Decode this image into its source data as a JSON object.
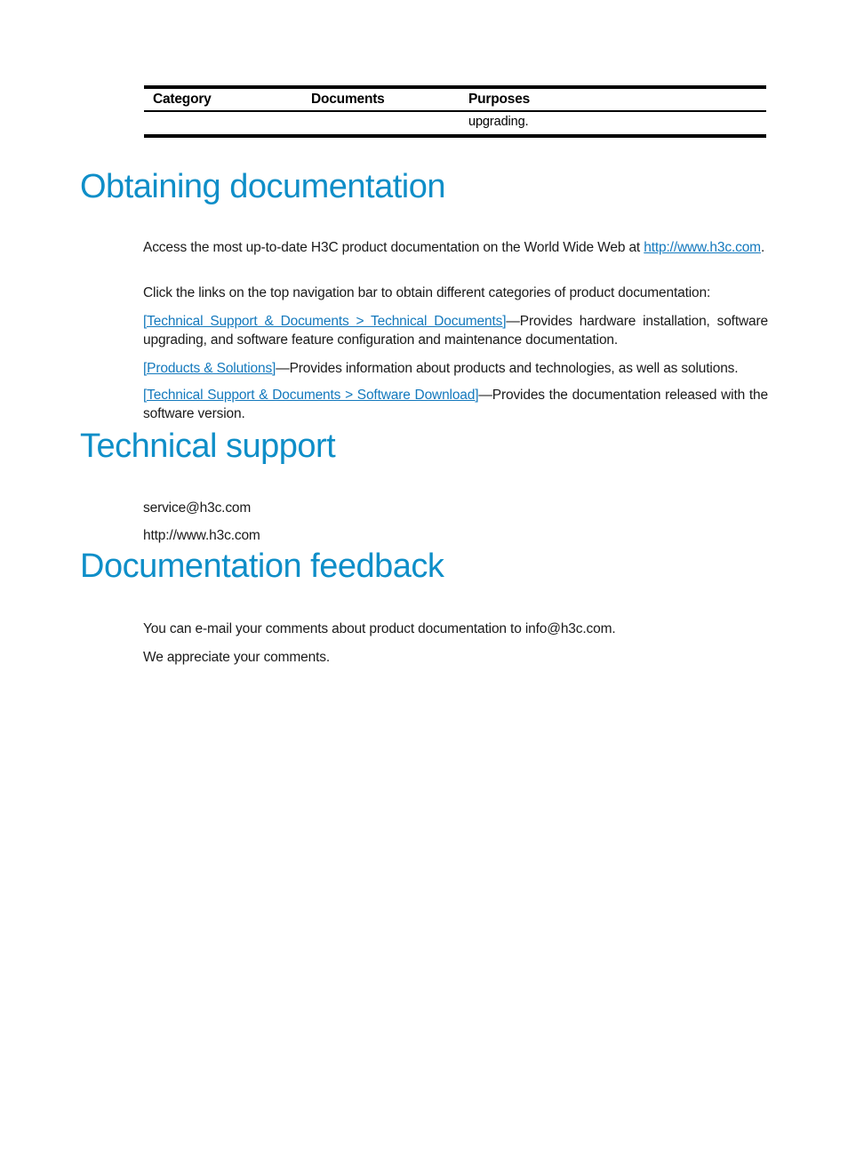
{
  "table": {
    "headers": {
      "category": "Category",
      "documents": "Documents",
      "purposes": "Purposes"
    },
    "rows": [
      {
        "category": "",
        "documents": "",
        "purposes": "upgrading."
      }
    ]
  },
  "colors": {
    "heading_blue": "#0e8ec8",
    "link_blue": "#1479bd",
    "rule_black": "#000000",
    "body_text": "#1a1a1a"
  },
  "sections": {
    "obtaining": {
      "heading": "Obtaining documentation",
      "paragraph_access_pre": "Access the most up-to-date H3C product documentation on the World Wide Web at ",
      "paragraph_access_link": "http://www.h3c.com",
      "paragraph_access_post": ".",
      "paragraph_click": "Click the links on the top navigation bar to obtain different categories of product documentation:",
      "links": [
        {
          "label": "[Technical Support & Documents > Technical Documents]",
          "separator": "—",
          "description": "Provides hardware installation, software upgrading, and software feature configuration and maintenance documentation."
        },
        {
          "label": "[Products & Solutions]",
          "separator": "—",
          "description": "Provides information about products and technologies, as well as solutions."
        },
        {
          "label": "[Technical Support & Documents > Software Download]",
          "separator": "—",
          "description": "Provides the documentation released with the software version."
        }
      ]
    },
    "technical_support": {
      "heading": "Technical support",
      "email": "service@h3c.com",
      "website": "http://www.h3c.com"
    },
    "documentation_feedback": {
      "heading": "Documentation feedback",
      "line1": "You can e-mail your comments about product documentation to info@h3c.com.",
      "line2": "We appreciate your comments."
    }
  }
}
